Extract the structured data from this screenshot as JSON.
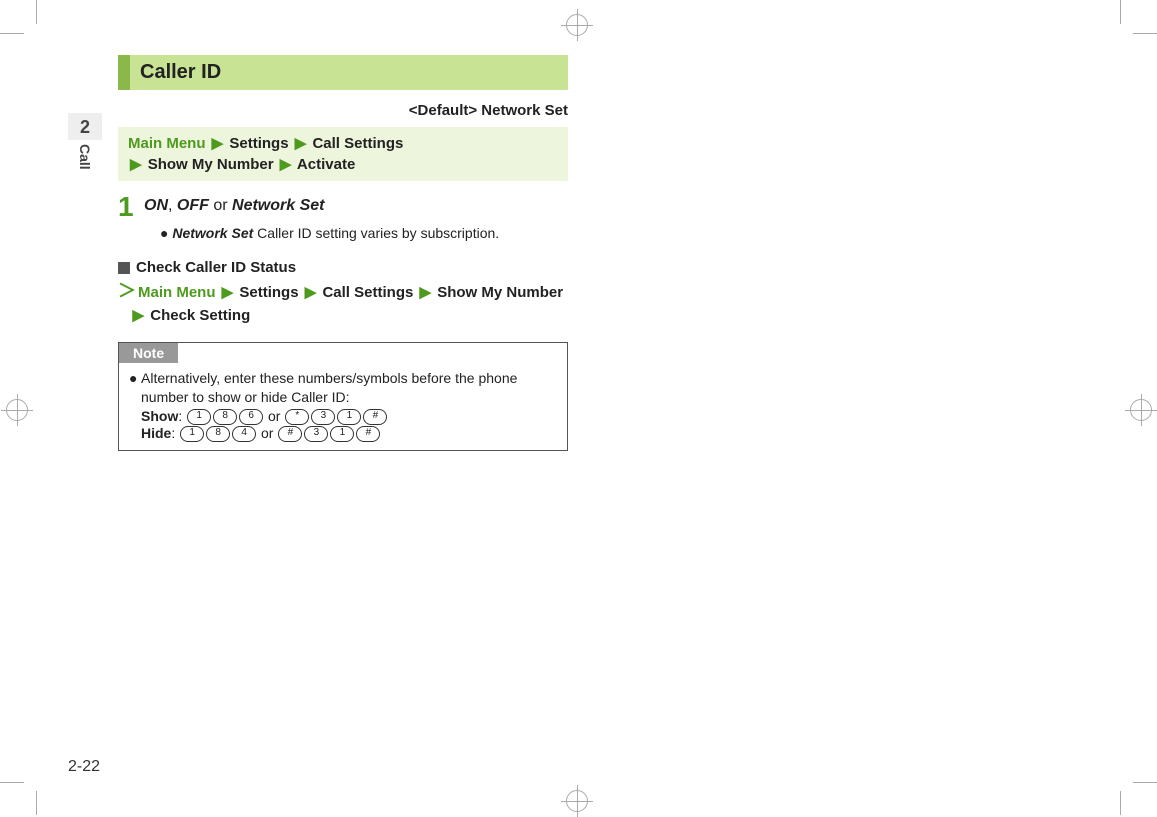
{
  "side": {
    "chapter": "2",
    "label": "Call"
  },
  "header": {
    "title": "Caller ID"
  },
  "default_line": "<Default> Network Set",
  "path1": {
    "p1": "Main Menu",
    "p2": "Settings",
    "p3": "Call Settings",
    "p4": "Show My Number",
    "p5": "Activate"
  },
  "step1": {
    "num": "1",
    "opt_on": "ON",
    "comma": ", ",
    "opt_off": "OFF",
    "or": " or ",
    "opt_ns": "Network Set",
    "note_term": "Network Set",
    "note_rest": " Caller ID setting varies by subscription."
  },
  "subhead": "Check Caller ID Status",
  "path2": {
    "p1": "Main Menu",
    "p2": "Settings",
    "p3": "Call Settings",
    "p4": "Show My Number",
    "p5": "Check Setting"
  },
  "note": {
    "label": "Note",
    "text": "Alternatively, enter these numbers/symbols before the phone number to show or hide Caller ID:",
    "show_label": "Show",
    "show_or": " or ",
    "hide_label": "Hide",
    "hide_or": " or ",
    "show_a": [
      "1",
      "8",
      "6"
    ],
    "show_b": [
      "*",
      "3",
      "1",
      "#"
    ],
    "hide_a": [
      "1",
      "8",
      "4"
    ],
    "hide_b": [
      "#",
      "3",
      "1",
      "#"
    ]
  },
  "page_number": "2-22",
  "arrow_glyph": "▶"
}
